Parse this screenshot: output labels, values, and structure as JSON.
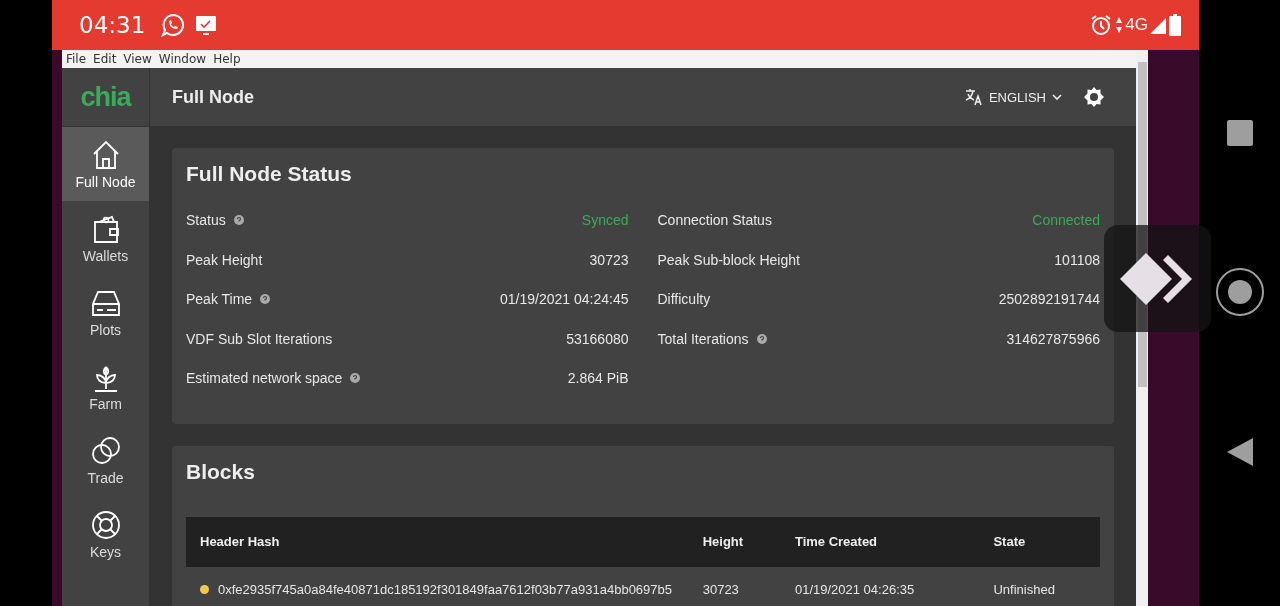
{
  "phone_status_bar": {
    "time": "04:31",
    "network": "4G"
  },
  "menu_bar": [
    "File",
    "Edit",
    "View",
    "Window",
    "Help"
  ],
  "sidebar": {
    "logo": "chia",
    "items": [
      {
        "label": "Full Node",
        "selected": true
      },
      {
        "label": "Wallets",
        "selected": false
      },
      {
        "label": "Plots",
        "selected": false
      },
      {
        "label": "Farm",
        "selected": false
      },
      {
        "label": "Trade",
        "selected": false
      },
      {
        "label": "Keys",
        "selected": false
      }
    ]
  },
  "header": {
    "title": "Full Node",
    "language": "ENGLISH"
  },
  "status_card": {
    "title": "Full Node Status",
    "columns": [
      [
        {
          "label": "Status",
          "help": true,
          "value": "Synced",
          "positive": true
        },
        {
          "label": "Peak Height",
          "help": false,
          "value": "30723",
          "positive": false
        },
        {
          "label": "Peak Time",
          "help": true,
          "value": "01/19/2021 04:24:45",
          "positive": false
        },
        {
          "label": "VDF Sub Slot Iterations",
          "help": false,
          "value": "53166080",
          "positive": false
        },
        {
          "label": "Estimated network space",
          "help": true,
          "value": "2.864 PiB",
          "positive": false
        }
      ],
      [
        {
          "label": "Connection Status",
          "help": false,
          "value": "Connected",
          "positive": true
        },
        {
          "label": "Peak Sub-block Height",
          "help": false,
          "value": "101108",
          "positive": false
        },
        {
          "label": "Difficulty",
          "help": false,
          "value": "2502892191744",
          "positive": false
        },
        {
          "label": "Total Iterations",
          "help": true,
          "value": "314627875966",
          "positive": false
        }
      ]
    ]
  },
  "blocks_card": {
    "title": "Blocks",
    "table": {
      "columns": [
        "Header Hash",
        "Height",
        "Time Created",
        "State"
      ],
      "rows": [
        {
          "color": "#f2c94c",
          "cells": [
            "0xfe2935f745a0a84fe40871dc185192f301849faa7612f03b77a931a4bb0697b5",
            "30723",
            "01/19/2021 04:26:35",
            "Unfinished"
          ]
        }
      ]
    }
  }
}
